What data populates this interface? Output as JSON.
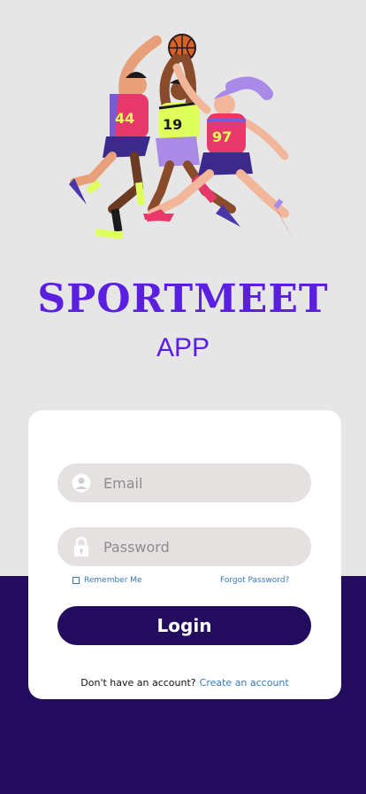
{
  "brand": {
    "title": "SPORTMEET",
    "subtitle": "APP"
  },
  "colors": {
    "accent": "#5b1fe0",
    "dark": "#230b5e",
    "link": "#3a78b5",
    "field_bg": "#e5e1e1",
    "background": "#e6e6e6"
  },
  "hero": {
    "icon": "basketball-players-illustration",
    "jerseys": [
      "44",
      "19",
      "97"
    ]
  },
  "login_form": {
    "email": {
      "placeholder": "Email",
      "value": "",
      "icon": "user-icon"
    },
    "password": {
      "placeholder": "Password",
      "value": "",
      "icon": "lock-icon"
    },
    "remember_label": "Remember Me",
    "forgot_label": "Forgot Password?",
    "login_label": "Login",
    "no_account_text": "Don't have an account?",
    "create_account_label": "Create an account"
  }
}
